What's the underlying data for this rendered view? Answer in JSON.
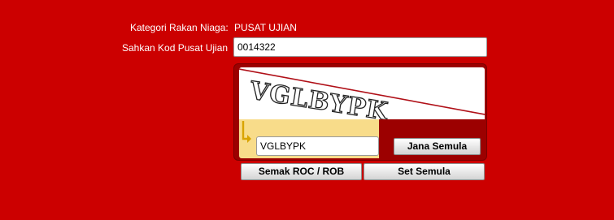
{
  "form": {
    "kategori_label": "Kategori Rakan Niaga:",
    "kategori_value": "PUSAT UJIAN",
    "kod_label": "Sahkan Kod Pusat Ujian",
    "kod_value": "0014322"
  },
  "captcha": {
    "image_text": "VGLBYPK",
    "answer_value": "VGLBYPK",
    "regenerate_label": "Jana Semula"
  },
  "actions": {
    "check_label": "Semak ROC / ROB",
    "reset_label": "Set Semula"
  },
  "colors": {
    "background": "#cc0000",
    "panel": "#9c0000",
    "answer_area": "#f8dc8a"
  },
  "icons": {
    "answer_arrow": "arrow-down-right-icon"
  }
}
